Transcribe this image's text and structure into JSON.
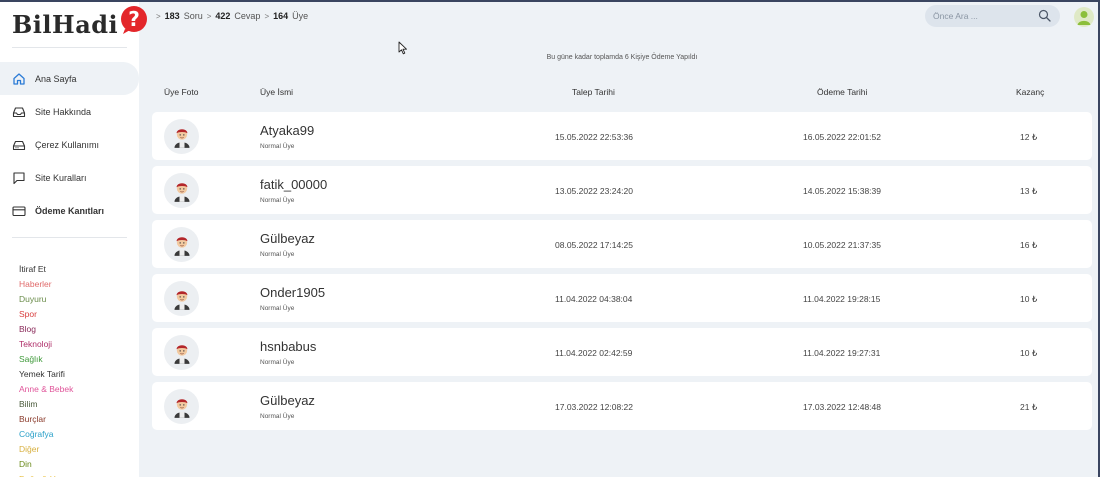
{
  "brand": {
    "name": "BilHadi",
    "mark": "?"
  },
  "breadcrumb": {
    "questions_count": "183",
    "questions_label": "Soru",
    "answers_count": "422",
    "answers_label": "Cevap",
    "members_count": "164",
    "members_label": "Üye"
  },
  "search": {
    "placeholder": "Önce Ara ..."
  },
  "nav": [
    {
      "label": "Ana Sayfa",
      "icon": "home-icon"
    },
    {
      "label": "Site Hakkında",
      "icon": "inbox-icon"
    },
    {
      "label": "Çerez Kullanımı",
      "icon": "drive-icon"
    },
    {
      "label": "Site Kuralları",
      "icon": "message-icon"
    },
    {
      "label": "Ödeme Kanıtları",
      "icon": "card-icon"
    }
  ],
  "categories": [
    {
      "label": "İtiraf Et",
      "color": "#333333"
    },
    {
      "label": "Haberler",
      "color": "#e06a6a"
    },
    {
      "label": "Duyuru",
      "color": "#6a8c4a"
    },
    {
      "label": "Spor",
      "color": "#d94040"
    },
    {
      "label": "Blog",
      "color": "#8a2a5a"
    },
    {
      "label": "Teknoloji",
      "color": "#b0306a"
    },
    {
      "label": "Sağlık",
      "color": "#3f9a3a"
    },
    {
      "label": "Yemek Tarifi",
      "color": "#333333"
    },
    {
      "label": "Anne & Bebek",
      "color": "#e0559a"
    },
    {
      "label": "Bilim",
      "color": "#4a5a3a"
    },
    {
      "label": "Burçlar",
      "color": "#8a3a2a"
    },
    {
      "label": "Coğrafya",
      "color": "#2aa0c8"
    },
    {
      "label": "Diğer",
      "color": "#d8b040"
    },
    {
      "label": "Din",
      "color": "#6a8a1a"
    },
    {
      "label": "Doğa & Hayvan",
      "color": "#e8c040"
    }
  ],
  "info_text": "Bu güne kadar toplamda 6 Kişiye Ödeme Yapıldı",
  "table": {
    "headers": {
      "photo": "Üye Foto",
      "name": "Üye İsmi",
      "request": "Talep Tarihi",
      "payment": "Ödeme Tarihi",
      "earning": "Kazanç"
    },
    "rows": [
      {
        "name": "Atyaka99",
        "role": "Normal Üye",
        "request": "15.05.2022 22:53:36",
        "payment": "16.05.2022 22:01:52",
        "earning": "12 ₺"
      },
      {
        "name": "fatik_00000",
        "role": "Normal Üye",
        "request": "13.05.2022 23:24:20",
        "payment": "14.05.2022 15:38:39",
        "earning": "13 ₺"
      },
      {
        "name": "Gülbeyaz",
        "role": "Normal Üye",
        "request": "08.05.2022 17:14:25",
        "payment": "10.05.2022 21:37:35",
        "earning": "16 ₺"
      },
      {
        "name": "Onder1905",
        "role": "Normal Üye",
        "request": "11.04.2022 04:38:04",
        "payment": "11.04.2022 19:28:15",
        "earning": "10 ₺"
      },
      {
        "name": "hsnbabus",
        "role": "Normal Üye",
        "request": "11.04.2022 02:42:59",
        "payment": "11.04.2022 19:27:31",
        "earning": "10 ₺"
      },
      {
        "name": "Gülbeyaz",
        "role": "Normal Üye",
        "request": "17.03.2022 12:08:22",
        "payment": "17.03.2022 12:48:48",
        "earning": "21 ₺"
      }
    ]
  }
}
